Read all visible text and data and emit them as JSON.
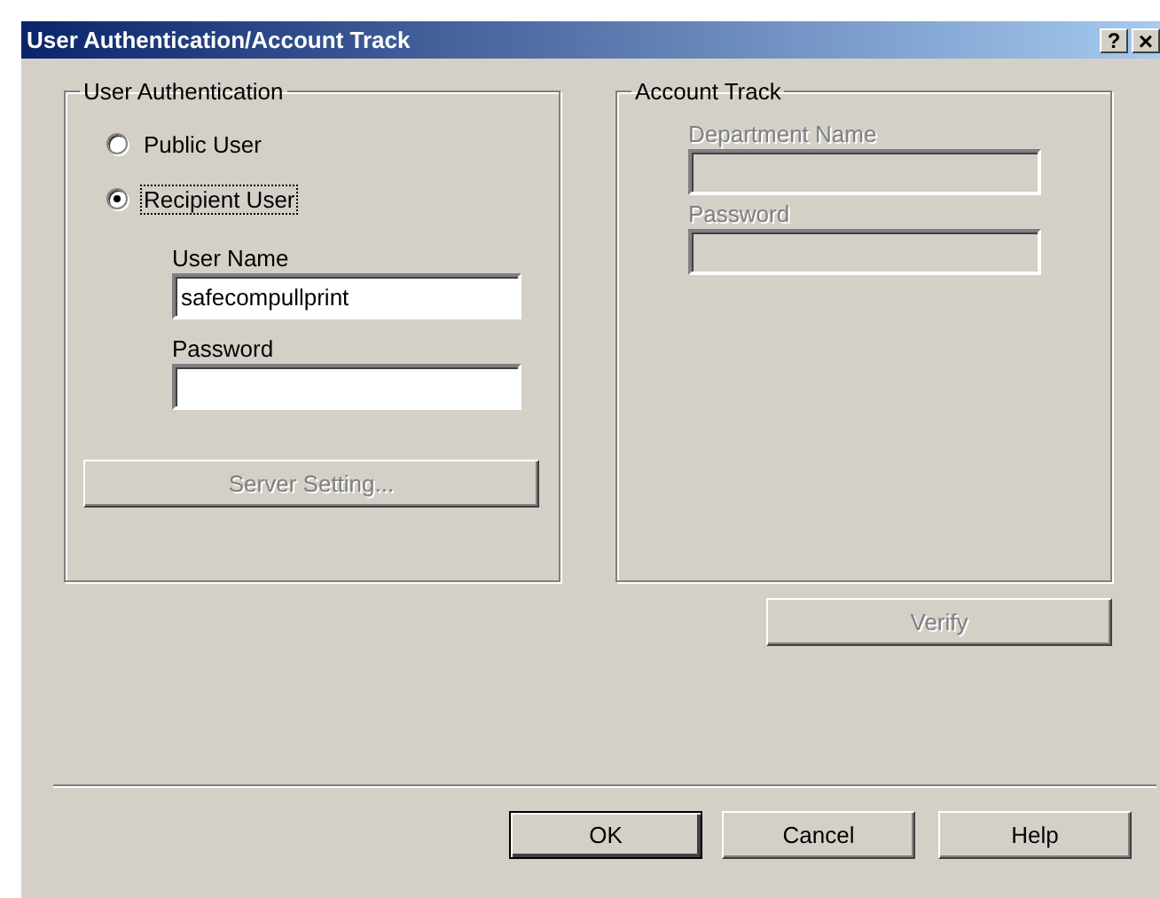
{
  "window": {
    "title": "User Authentication/Account Track",
    "title_buttons": [
      {
        "kind": "help",
        "label": "?"
      },
      {
        "kind": "close",
        "label": "×"
      }
    ]
  },
  "user_authentication": {
    "title": "User Authentication",
    "options": [
      {
        "label": "Public User",
        "selected": false,
        "focused": false
      },
      {
        "label": "Recipient User",
        "selected": true,
        "focused": true
      }
    ],
    "fields": [
      {
        "label": "User Name",
        "value": "safecompullprint",
        "disabled": false
      },
      {
        "label": "Password",
        "disabled": false
      }
    ],
    "server_button": {
      "label": "Server Setting...",
      "disabled": true
    }
  },
  "account_track": {
    "title": "Account Track",
    "fields": [
      {
        "label": "Department Name",
        "disabled": true
      },
      {
        "label": "Password",
        "disabled": true
      }
    ],
    "verify_button": {
      "label": "Verify",
      "disabled": true
    }
  },
  "buttons": [
    {
      "label": "OK",
      "default": true
    },
    {
      "label": "Cancel",
      "default": false
    },
    {
      "label": "Help",
      "default": false
    }
  ]
}
